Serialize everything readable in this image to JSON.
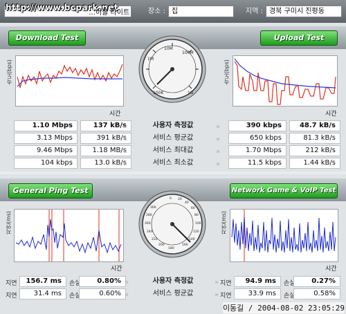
{
  "topbar": {
    "watermark": "http://www.bcpark.net",
    "provider_value": "…이블 라이트",
    "location_label": "장소 :",
    "location_value": "집",
    "region_label": "지역 :",
    "region_value": "경북 구미시 진평동"
  },
  "speed_section": {
    "download_button": "Download Test",
    "upload_button": "Upload Test",
    "y_axis_label": "속도(bps)",
    "x_axis_label": "시간",
    "row_labels": [
      "사용자 측정값",
      "서비스 평균값",
      "서비스 최대값",
      "서비스 최소값"
    ],
    "download_rows": [
      {
        "bps": "1.10 Mbps",
        "Bps": "137 kB/s"
      },
      {
        "bps": "3.13 Mbps",
        "Bps": "391 kB/s"
      },
      {
        "bps": "9.46 Mbps",
        "Bps": "1.18 MB/s"
      },
      {
        "bps": "104 kbps",
        "Bps": "13.0 kB/s"
      }
    ],
    "upload_rows": [
      {
        "bps": "390 kbps",
        "Bps": "48.7 kB/s"
      },
      {
        "bps": "650 kbps",
        "Bps": "81.3 kB/s"
      },
      {
        "bps": "1.70 Mbps",
        "Bps": "212 kB/s"
      },
      {
        "bps": "11.5 kbps",
        "Bps": "1.44 kB/s"
      }
    ],
    "gauge_labels": [
      "100K",
      "1M",
      "10M",
      "100M",
      "1G"
    ]
  },
  "ping_section": {
    "ping_button": "General Ping Test",
    "game_button": "Network Game & VoIP Test",
    "y_axis_label": "지연(ms)",
    "x_axis_label": "시간",
    "row_labels": [
      "사용자 측정값",
      "서비스 평균값"
    ],
    "side_labels": [
      "지연",
      "손실"
    ],
    "ping_rows": [
      {
        "delay": "156.7 ms",
        "loss": "0.80%"
      },
      {
        "delay": "31.4 ms",
        "loss": "0.60%"
      }
    ],
    "game_rows": [
      {
        "delay": "94.9 ms",
        "loss": "0.27%"
      },
      {
        "delay": "33.9 ms",
        "loss": "0.58%"
      }
    ],
    "gauge_ticks": [
      "0",
      "20",
      "40",
      "60",
      "80",
      "100",
      "120",
      "140",
      "160",
      "180",
      "200",
      "220",
      "240",
      "260",
      "280",
      "300"
    ]
  },
  "footer": {
    "text": "이동길 / 2004-08-02 23:05:29"
  },
  "colors": {
    "green_button": "#2aa82a",
    "measured_line": "#e0301e",
    "average_line": "#2b38d8",
    "ping_line": "#1a2bd0",
    "ping_spike": "#e0301e"
  }
}
